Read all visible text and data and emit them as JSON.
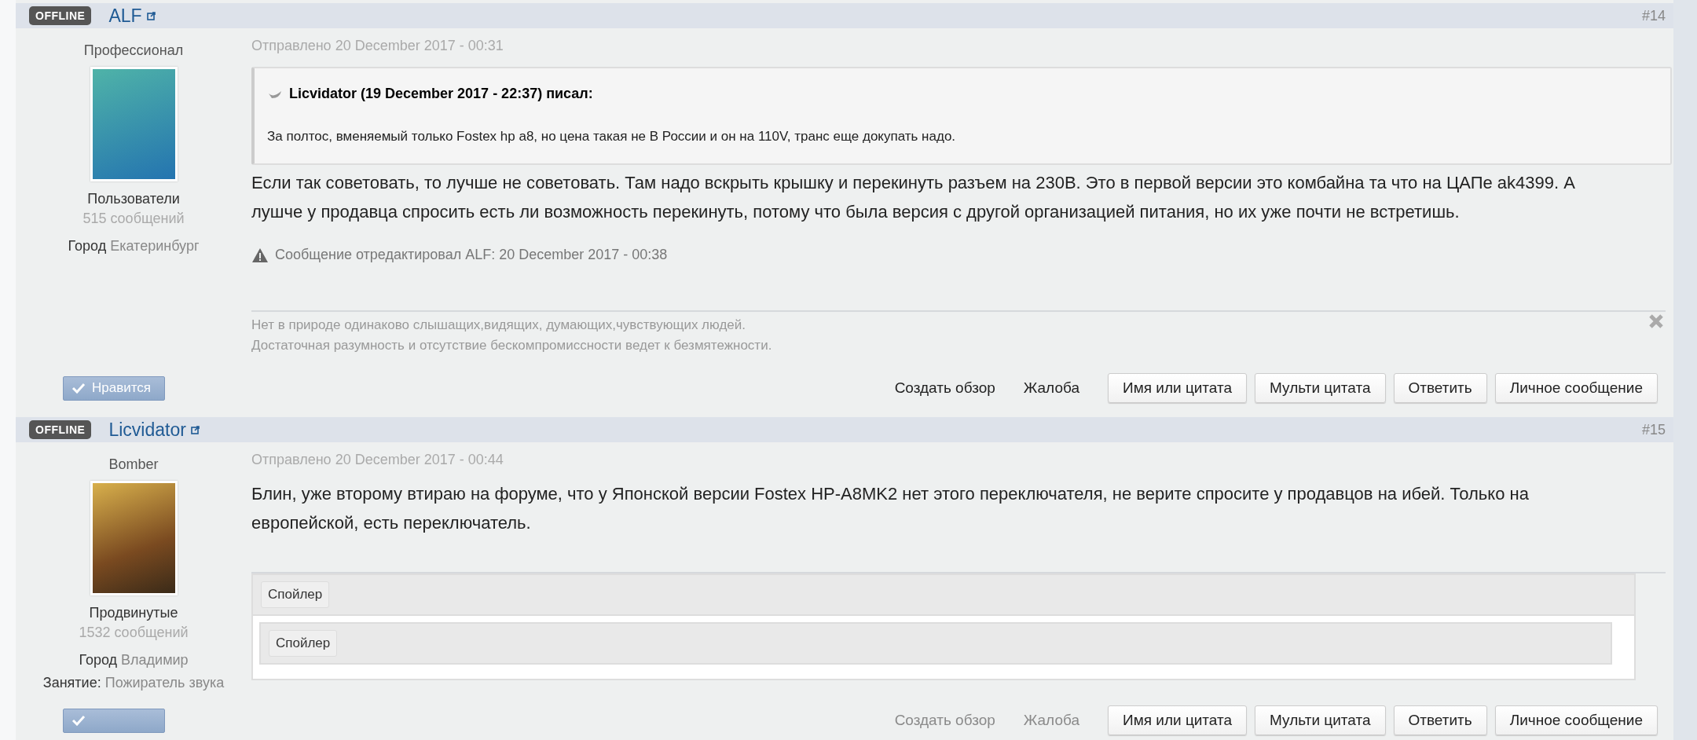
{
  "posts": [
    {
      "status": "OFFLINE",
      "author": "ALF",
      "number": "#14",
      "rank": "Профессионал",
      "group": "Пользователи",
      "post_count": "515 сообщений",
      "fields": [
        {
          "label": "Город",
          "value": "Екатеринбург"
        }
      ],
      "like_button": true,
      "like_label": "Нравится",
      "date": "Отправлено 20 December 2017 - 00:31",
      "quote": {
        "title": "Licvidator (19 December 2017 - 22:37) писал:",
        "text": "За полтос, вменяемый только Fostex hp a8, но цена такая не В России и он на 110V, транс еще докупать надо."
      },
      "body": "Если так советовать, то лучше не советовать. Там надо вскрыть крышку и перекинуть разъем на 230В. Это в первой версии это комбайна та что на ЦАПе ak4399. А лушче у продавца спросить есть ли возможность перекинуть, потому что была версия с другой организацией питания, но их уже почти не встретишь.",
      "edit_note": "Сообщение отредактировал ALF: 20 December 2017 - 00:38",
      "signature": [
        "Нет в природе одинаково слышащих,видящих, думающих,чувствующих людей.",
        "Достаточная разумность и отсутствие бескомпромиссности ведет к безмятежности."
      ],
      "actions": [
        {
          "label": "Создать обзор",
          "kind": "link",
          "disabled": false
        },
        {
          "label": "Жалоба",
          "kind": "link",
          "disabled": false
        },
        {
          "label": "Имя или цитата",
          "kind": "button",
          "disabled": false
        },
        {
          "label": "Мульти цитата",
          "kind": "button",
          "disabled": false
        },
        {
          "label": "Ответить",
          "kind": "button",
          "disabled": false
        },
        {
          "label": "Личное сообщение",
          "kind": "button",
          "disabled": false
        }
      ]
    },
    {
      "status": "OFFLINE",
      "author": "Licvidator",
      "number": "#15",
      "rank": "Bomber",
      "group": "Продвинутые",
      "post_count": "1532 сообщений",
      "fields": [
        {
          "label": "Город",
          "value": "Владимир"
        },
        {
          "label": "Занятие:",
          "value": "Пожиратель звука"
        }
      ],
      "like_button": true,
      "date": "Отправлено 20 December 2017 - 00:44",
      "body": "Блин, уже второму втираю на форуме, что у Японской версии Fostex HP-A8MK2 нет этого переключателя, не верите спросите у продавцов на ибей. Только на европейской, есть переключатель.",
      "spoiler": {
        "label": "Спойлер",
        "children": [
          {
            "label": "Спойлер"
          }
        ]
      },
      "actions": [
        {
          "label": "Создать обзор",
          "kind": "link",
          "disabled": true
        },
        {
          "label": "Жалоба",
          "kind": "link",
          "disabled": true
        },
        {
          "label": "Имя или цитата",
          "kind": "button",
          "disabled": false
        },
        {
          "label": "Мульти цитата",
          "kind": "button",
          "disabled": false
        },
        {
          "label": "Ответить",
          "kind": "button",
          "disabled": false
        },
        {
          "label": "Личное сообщение",
          "kind": "button",
          "disabled": false
        }
      ]
    }
  ]
}
